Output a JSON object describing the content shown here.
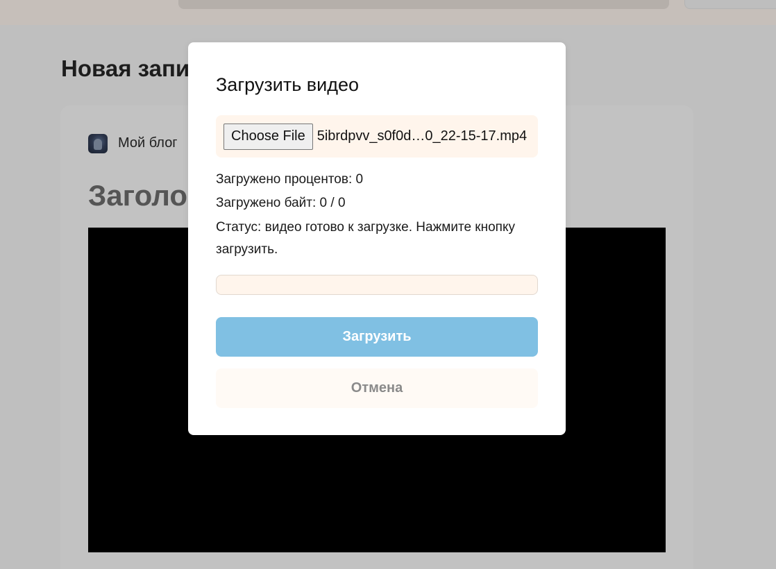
{
  "background_page": {
    "heading": "Новая запи",
    "blog_name": "Мой блог",
    "post_title": "Заголо"
  },
  "modal": {
    "title": "Загрузить видео",
    "choose_file_label": "Choose File",
    "file_name": "5ibrdpvv_s0f0d…0_22-15-17.mp4",
    "uploaded_percent_text": "Загружено процентов: 0",
    "uploaded_bytes_text": "Загружено байт: 0 / 0",
    "status_text": "Статус: видео готово к загрузке. Нажмите кнопку загрузить.",
    "progress_fraction": 0,
    "upload_button_label": "Загрузить",
    "cancel_button_label": "Отмена"
  },
  "colors": {
    "primary_button": "#80c0e3",
    "file_box_background": "#fff5ec",
    "overlay_dim": "#bfbfbf"
  }
}
